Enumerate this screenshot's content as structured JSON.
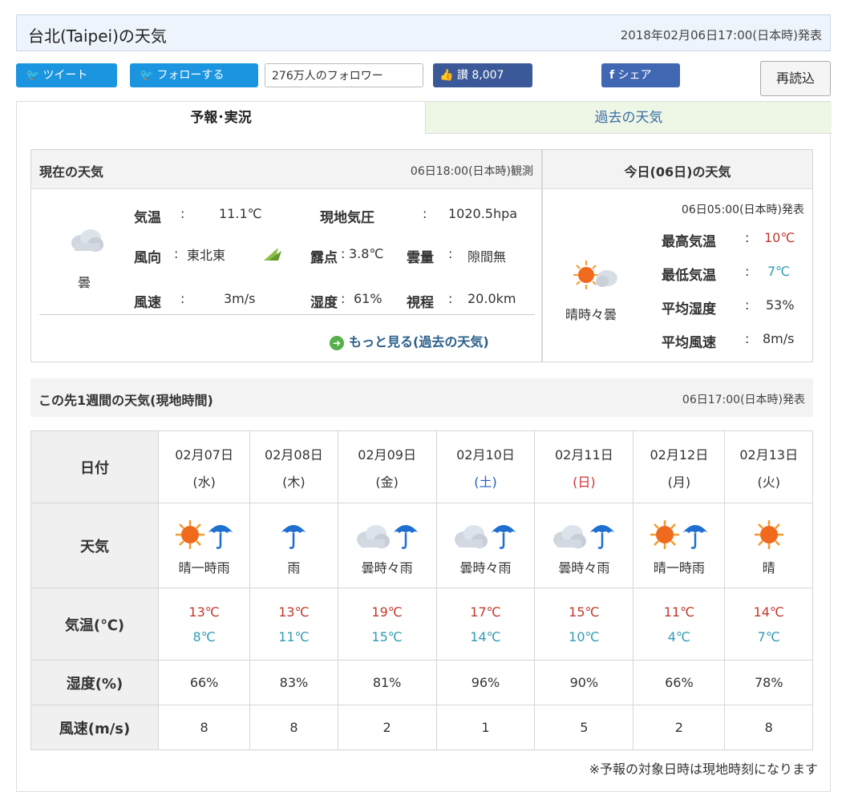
{
  "title": "台北(Taipei)の天気",
  "published": "2018年02月06日17:00(日本時)発表",
  "social": {
    "tweet": "ツイート",
    "follow": "フォローする",
    "followers": "276万人のフォロワー",
    "like_count": "讃 8,007",
    "share": "シェア",
    "reload": "再読込"
  },
  "tabs": {
    "forecast": "予報･実況",
    "past": "過去の天気"
  },
  "current": {
    "heading": "現在の天気",
    "observed": "06日18:00(日本時)観測",
    "condition": "曇",
    "temp_label": "気温",
    "temp": "11.1℃",
    "pressure_label": "現地気圧",
    "pressure": "1020.5hpa",
    "wind_dir_label": "風向",
    "wind_dir": "東北東",
    "dew_label": "露点",
    "dew": "3.8℃",
    "cloud_label": "雲量",
    "cloud": "隙間無",
    "wind_speed_label": "風速",
    "wind_speed": "3m/s",
    "humidity_label": "湿度",
    "humidity": "61%",
    "visibility_label": "視程",
    "visibility": "20.0km",
    "more": "もっと見る(過去の天気)"
  },
  "today": {
    "heading": "今日(06日)の天気",
    "published": "06日05:00(日本時)発表",
    "condition": "晴時々曇",
    "max_label": "最高気温",
    "max": "10℃",
    "min_label": "最低気温",
    "min": "7℃",
    "hum_label": "平均湿度",
    "hum": "53%",
    "wind_label": "平均風速",
    "wind": "8m/s"
  },
  "week": {
    "heading": "この先1週間の天気(現地時間)",
    "published": "06日17:00(日本時)発表",
    "row_date": "日付",
    "row_weather": "天気",
    "row_temp": "気温(℃)",
    "row_humidity": "湿度(%)",
    "row_wind": "風速(m/s)",
    "days": [
      {
        "date": "02月07日",
        "dow": "(水)",
        "dow_color": "#333",
        "weather": "晴一時雨",
        "icon": "sun-umbrella",
        "hi": "13℃",
        "lo": "8℃",
        "hum": "66%",
        "wind": "8"
      },
      {
        "date": "02月08日",
        "dow": "(木)",
        "dow_color": "#333",
        "weather": "雨",
        "icon": "umbrella",
        "hi": "13℃",
        "lo": "11℃",
        "hum": "83%",
        "wind": "8"
      },
      {
        "date": "02月09日",
        "dow": "(金)",
        "dow_color": "#333",
        "weather": "曇時々雨",
        "icon": "cloud-umbrella",
        "hi": "19℃",
        "lo": "15℃",
        "hum": "81%",
        "wind": "2"
      },
      {
        "date": "02月10日",
        "dow": "(土)",
        "dow_color": "#1f5fbf",
        "weather": "曇時々雨",
        "icon": "cloud-umbrella",
        "hi": "17℃",
        "lo": "14℃",
        "hum": "96%",
        "wind": "1"
      },
      {
        "date": "02月11日",
        "dow": "(日)",
        "dow_color": "#d03030",
        "weather": "曇時々雨",
        "icon": "cloud-umbrella",
        "hi": "15℃",
        "lo": "10℃",
        "hum": "90%",
        "wind": "5"
      },
      {
        "date": "02月12日",
        "dow": "(月)",
        "dow_color": "#333",
        "weather": "晴一時雨",
        "icon": "sun-umbrella",
        "hi": "11℃",
        "lo": "4℃",
        "hum": "66%",
        "wind": "2"
      },
      {
        "date": "02月13日",
        "dow": "(火)",
        "dow_color": "#333",
        "weather": "晴",
        "icon": "sun",
        "hi": "14℃",
        "lo": "7℃",
        "hum": "78%",
        "wind": "8"
      }
    ]
  },
  "note": "※予報の対象日時は現地時刻になります"
}
